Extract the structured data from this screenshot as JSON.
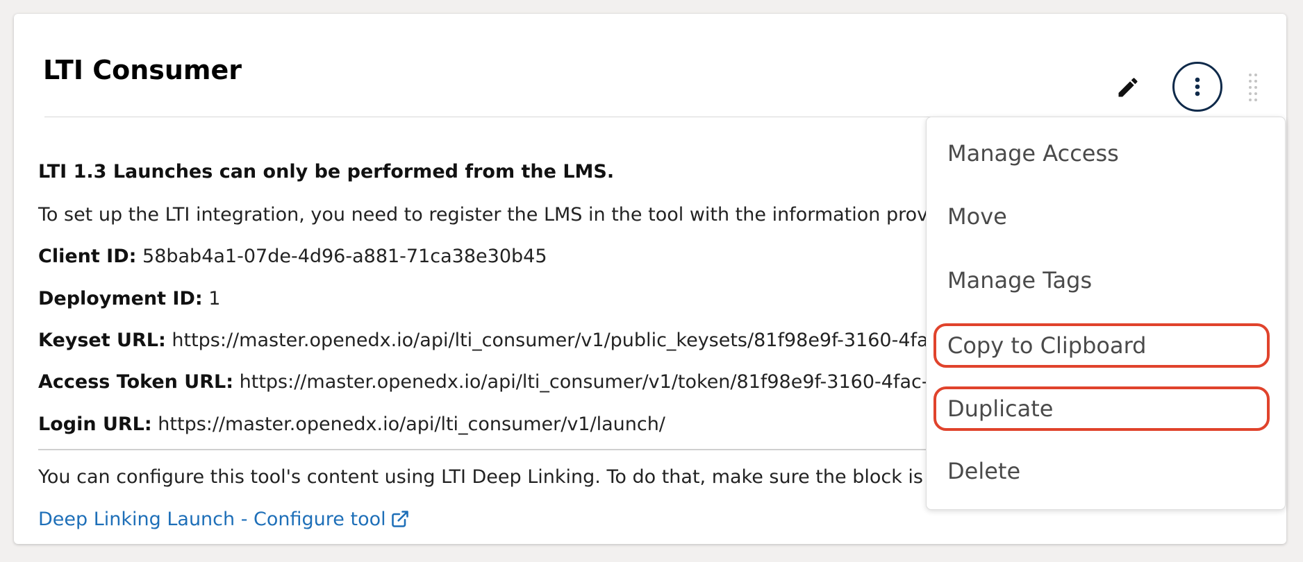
{
  "block": {
    "title": "LTI Consumer",
    "warning": "LTI 1.3 Launches can only be performed from the LMS.",
    "setup_text": "To set up the LTI integration, you need to register the LMS in the tool with the information prov",
    "client_id": {
      "label": "Client ID:",
      "value": "58bab4a1-07de-4d96-a881-71ca38e30b45"
    },
    "deployment_id": {
      "label": "Deployment ID:",
      "value": "1"
    },
    "keyset_url": {
      "label": "Keyset URL:",
      "value": "https://master.openedx.io/api/lti_consumer/v1/public_keysets/81f98e9f-3160-4fa"
    },
    "access_token_url": {
      "label": "Access Token URL:",
      "value": "https://master.openedx.io/api/lti_consumer/v1/token/81f98e9f-3160-4fac-"
    },
    "login_url": {
      "label": "Login URL:",
      "value": "https://master.openedx.io/api/lti_consumer/v1/launch/"
    },
    "deep_linking_text": "You can configure this tool's content using LTI Deep Linking. To do that, make sure the block is",
    "deep_link_label": "Deep Linking Launch - Configure tool"
  },
  "toolbar": {
    "edit_icon": "pencil-icon",
    "more_icon": "more-vertical-icon",
    "drag_icon": "drag-handle-icon"
  },
  "menu": {
    "items": [
      {
        "label": "Manage Access",
        "highlighted": false
      },
      {
        "label": "Move",
        "highlighted": false
      },
      {
        "label": "Manage Tags",
        "highlighted": false
      },
      {
        "label": "Copy to Clipboard",
        "highlighted": true
      },
      {
        "label": "Duplicate",
        "highlighted": true
      },
      {
        "label": "Delete",
        "highlighted": false
      }
    ]
  },
  "colors": {
    "link": "#1e6fb8",
    "more_button_border": "#0f2a4a",
    "highlight": "#e0432c"
  }
}
